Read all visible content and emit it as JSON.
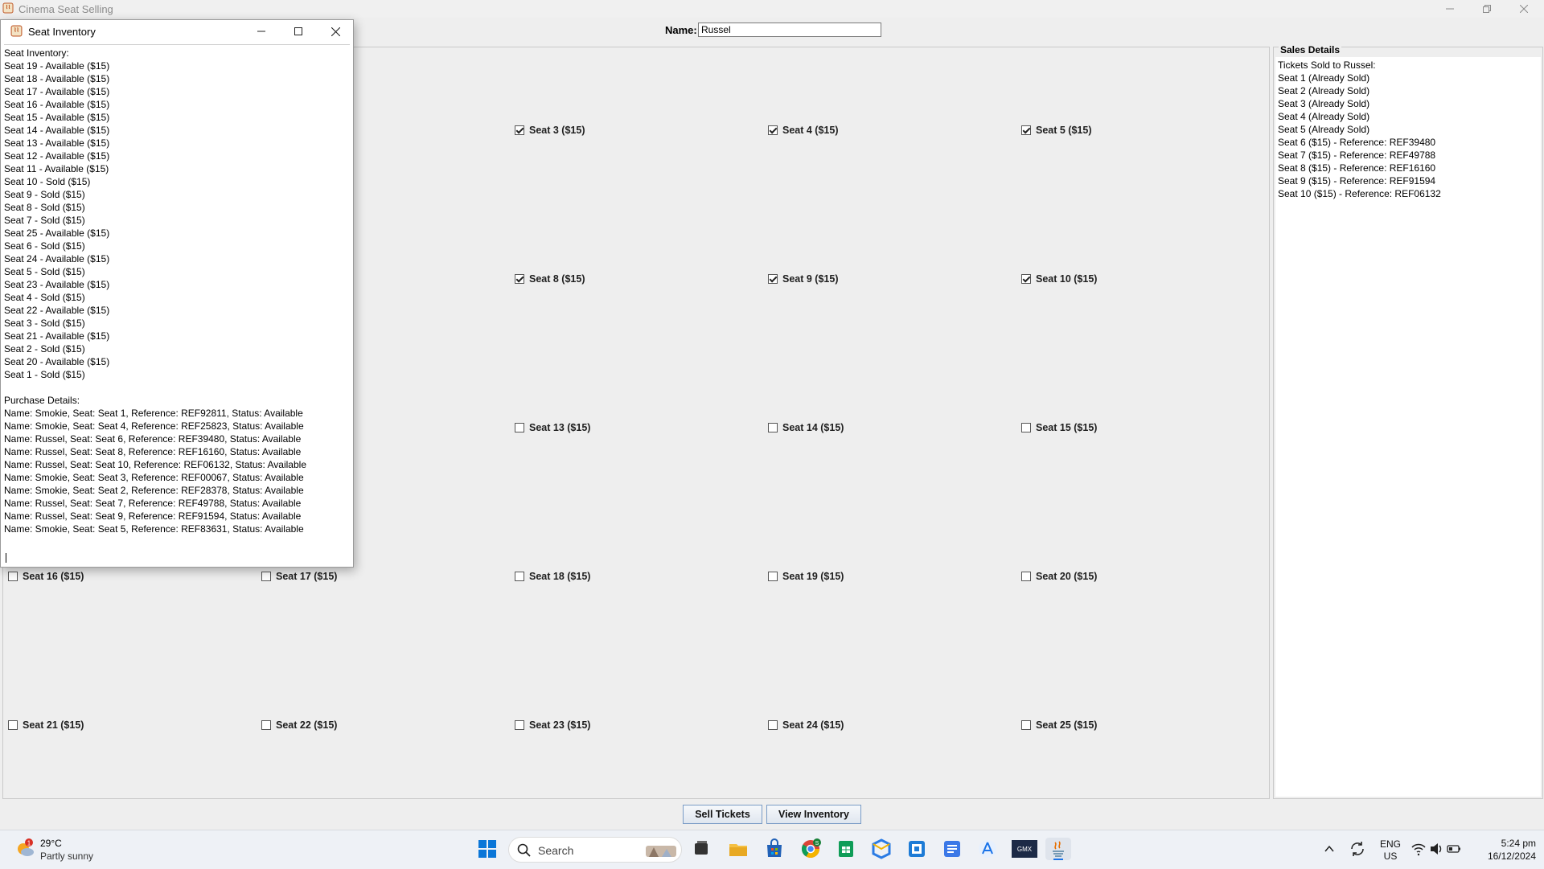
{
  "window": {
    "title": "Cinema Seat Selling"
  },
  "name_field": {
    "label": "Name:",
    "value": "Russel"
  },
  "seats": [
    {
      "label": "Seat 3 ($15)",
      "checked": true
    },
    {
      "label": "Seat 4 ($15)",
      "checked": true
    },
    {
      "label": "Seat 5 ($15)",
      "checked": true
    },
    {
      "label": "Seat 8 ($15)",
      "checked": true
    },
    {
      "label": "Seat 9 ($15)",
      "checked": true
    },
    {
      "label": "Seat 10 ($15)",
      "checked": true
    },
    {
      "label": "Seat 13 ($15)",
      "checked": false
    },
    {
      "label": "Seat 14 ($15)",
      "checked": false
    },
    {
      "label": "Seat 15 ($15)",
      "checked": false
    },
    {
      "label": "Seat 16 ($15)",
      "checked": false
    },
    {
      "label": "Seat 17 ($15)",
      "checked": false
    },
    {
      "label": "Seat 18 ($15)",
      "checked": false
    },
    {
      "label": "Seat 19 ($15)",
      "checked": false
    },
    {
      "label": "Seat 20 ($15)",
      "checked": false
    },
    {
      "label": "Seat 21 ($15)",
      "checked": false
    },
    {
      "label": "Seat 22 ($15)",
      "checked": false
    },
    {
      "label": "Seat 23 ($15)",
      "checked": false
    },
    {
      "label": "Seat 24 ($15)",
      "checked": false
    },
    {
      "label": "Seat 25 ($15)",
      "checked": false
    }
  ],
  "sales": {
    "title": "Sales Details",
    "lines": [
      "Tickets Sold to Russel:",
      "Seat 1 (Already Sold)",
      "Seat 2 (Already Sold)",
      "Seat 3 (Already Sold)",
      "Seat 4 (Already Sold)",
      "Seat 5 (Already Sold)",
      "Seat 6 ($15) - Reference: REF39480",
      "Seat 7 ($15) - Reference: REF49788",
      "Seat 8 ($15) - Reference: REF16160",
      "Seat 9 ($15) - Reference: REF91594",
      "Seat 10 ($15) - Reference: REF06132"
    ]
  },
  "buttons": {
    "sell": "Sell Tickets",
    "view": "View Inventory"
  },
  "inventory_dialog": {
    "title": "Seat Inventory",
    "lines": [
      "Seat Inventory:",
      "Seat 19 - Available ($15)",
      "Seat 18 - Available ($15)",
      "Seat 17 - Available ($15)",
      "Seat 16 - Available ($15)",
      "Seat 15 - Available ($15)",
      "Seat 14 - Available ($15)",
      "Seat 13 - Available ($15)",
      "Seat 12 - Available ($15)",
      "Seat 11 - Available ($15)",
      "Seat 10 - Sold ($15)",
      "Seat 9 - Sold ($15)",
      "Seat 8 - Sold ($15)",
      "Seat 7 - Sold ($15)",
      "Seat 25 - Available ($15)",
      "Seat 6 - Sold ($15)",
      "Seat 24 - Available ($15)",
      "Seat 5 - Sold ($15)",
      "Seat 23 - Available ($15)",
      "Seat 4 - Sold ($15)",
      "Seat 22 - Available ($15)",
      "Seat 3 - Sold ($15)",
      "Seat 21 - Available ($15)",
      "Seat 2 - Sold ($15)",
      "Seat 20 - Available ($15)",
      "Seat 1 - Sold ($15)",
      "",
      "Purchase Details:",
      "Name: Smokie, Seat: Seat 1, Reference: REF92811, Status: Available",
      "Name: Smokie, Seat: Seat 4, Reference: REF25823, Status: Available",
      "Name: Russel, Seat: Seat 6, Reference: REF39480, Status: Available",
      "Name: Russel, Seat: Seat 8, Reference: REF16160, Status: Available",
      "Name: Russel, Seat: Seat 10, Reference: REF06132, Status: Available",
      "Name: Smokie, Seat: Seat 3, Reference: REF00067, Status: Available",
      "Name: Smokie, Seat: Seat 2, Reference: REF28378, Status: Available",
      "Name: Russel, Seat: Seat 7, Reference: REF49788, Status: Available",
      "Name: Russel, Seat: Seat 9, Reference: REF91594, Status: Available",
      "Name: Smokie, Seat: Seat 5, Reference: REF83631, Status: Available"
    ]
  },
  "taskbar": {
    "weather": {
      "temp": "29°C",
      "desc": "Partly sunny",
      "badge": "1"
    },
    "search_placeholder": "Search",
    "language": {
      "top": "ENG",
      "bottom": "US"
    },
    "time": "5:24 pm",
    "date": "16/12/2024",
    "chrome_badge": "S",
    "icons": [
      "start-icon",
      "file-explorer-icon",
      "folder-icon",
      "store-icon",
      "chrome-icon",
      "sheets-icon",
      "office-icon",
      "terminal-icon",
      "docs-icon",
      "app-store-icon",
      "gmx-icon",
      "java-icon"
    ]
  }
}
